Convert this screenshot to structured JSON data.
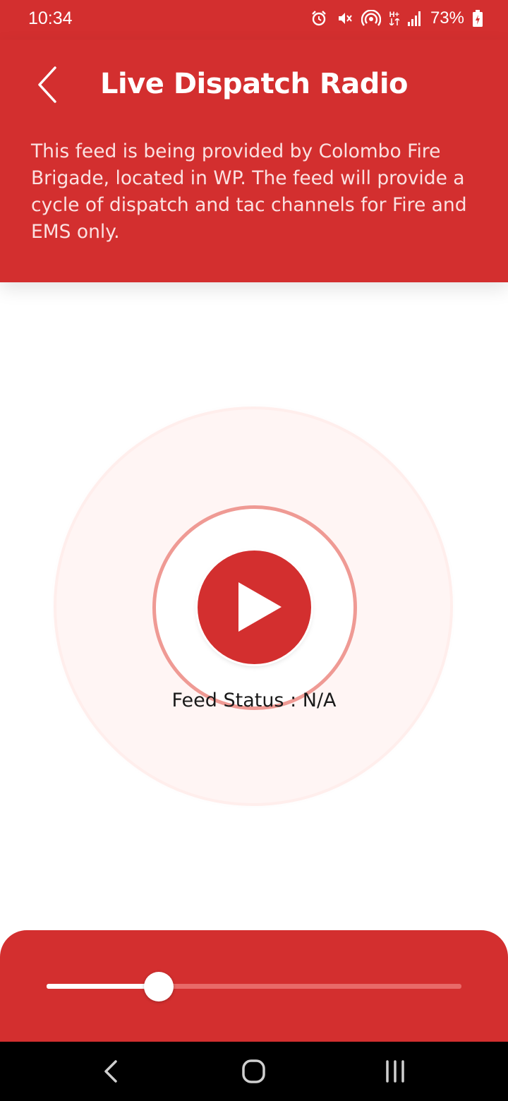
{
  "status_bar": {
    "time": "10:34",
    "battery_percent": "73%",
    "network_label": "H+",
    "icons": [
      "alarm-icon",
      "vibrate-mute-icon",
      "hotspot-icon",
      "network-type-icon",
      "signal-icon",
      "battery-icon"
    ]
  },
  "header": {
    "back_icon": "chevron-left-icon",
    "title": "Live Dispatch Radio",
    "description": "This feed is being provided by Colombo Fire Brigade, located in WP. The feed will provide a cycle of dispatch and tac channels for Fire and EMS only."
  },
  "player": {
    "play_icon": "play-icon",
    "feed_status": "Feed Status : N/A"
  },
  "volume": {
    "level": 0.27
  },
  "nav_bar": {
    "items": [
      "back-nav-icon",
      "home-nav-icon",
      "recents-nav-icon"
    ]
  },
  "colors": {
    "primary": "#d32f2f",
    "ring": "#ef9a94",
    "halo": "#fff5f4"
  }
}
